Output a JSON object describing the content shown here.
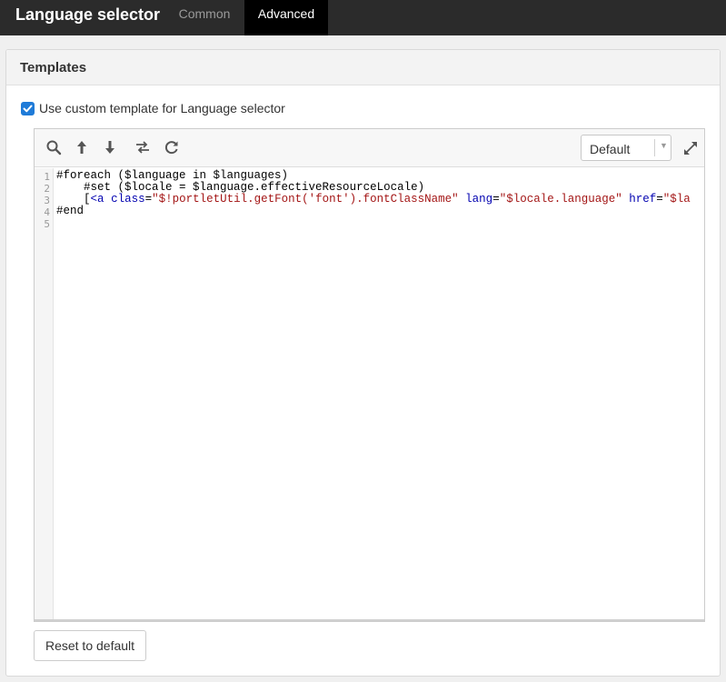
{
  "header": {
    "title": "Language selector",
    "tabs": [
      {
        "label": "Common",
        "active": false
      },
      {
        "label": "Advanced",
        "active": true
      }
    ]
  },
  "panel": {
    "title": "Templates",
    "checkbox_label": "Use custom template for Language selector",
    "checkbox_checked": true
  },
  "editor": {
    "toolbar_icons": [
      "search-icon",
      "arrow-up-icon",
      "arrow-down-icon",
      "swap-icon",
      "refresh-icon"
    ],
    "theme_selected": "Default",
    "line_numbers": [
      "1",
      "2",
      "3",
      "4",
      "5"
    ],
    "lines": [
      {
        "indent": "",
        "parts": [
          {
            "t": "#foreach ($language in $languages)",
            "c": "plain"
          }
        ]
      },
      {
        "indent": "    ",
        "parts": [
          {
            "t": "#set ($locale = $language.effectiveResourceLocale)",
            "c": "plain"
          }
        ]
      },
      {
        "indent": "    ",
        "parts": [
          {
            "t": "[",
            "c": "plain"
          },
          {
            "t": "<a",
            "c": "tag"
          },
          {
            "t": " ",
            "c": "plain"
          },
          {
            "t": "class",
            "c": "attr"
          },
          {
            "t": "=",
            "c": "plain"
          },
          {
            "t": "\"$!portletUtil.getFont('font').fontClassName\"",
            "c": "str"
          },
          {
            "t": " ",
            "c": "plain"
          },
          {
            "t": "lang",
            "c": "attr"
          },
          {
            "t": "=",
            "c": "plain"
          },
          {
            "t": "\"$locale.language\"",
            "c": "str"
          },
          {
            "t": " ",
            "c": "plain"
          },
          {
            "t": "href",
            "c": "attr"
          },
          {
            "t": "=",
            "c": "plain"
          },
          {
            "t": "\"$la",
            "c": "str"
          }
        ]
      },
      {
        "indent": "",
        "parts": [
          {
            "t": "#end",
            "c": "plain"
          }
        ]
      },
      {
        "indent": "",
        "parts": []
      }
    ],
    "accent_color": "#1f7bd8"
  },
  "footer": {
    "reset_label": "Reset to default"
  }
}
